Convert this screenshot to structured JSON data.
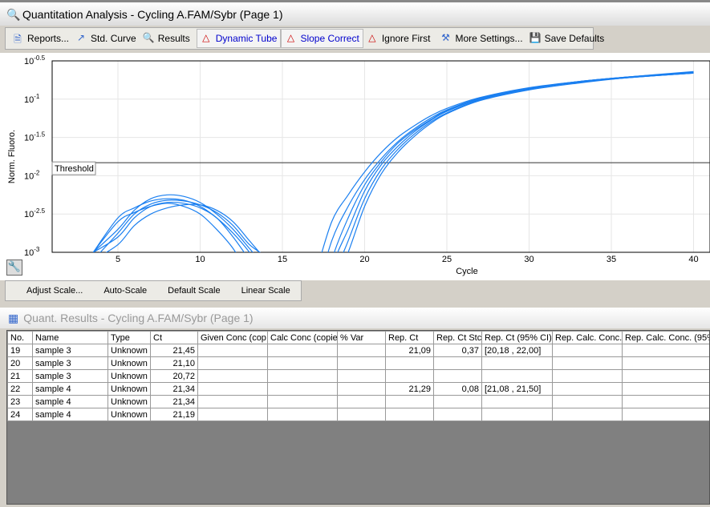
{
  "window": {
    "title": "Quantitation Analysis - Cycling A.FAM/Sybr (Page 1)"
  },
  "toolbar": [
    {
      "label": "Reports...",
      "icon": "report-icon",
      "active": false
    },
    {
      "label": "Std. Curve",
      "icon": "std-curve-icon",
      "active": false
    },
    {
      "label": "Results",
      "icon": "results-icon",
      "active": false
    },
    {
      "label": "Dynamic Tube",
      "icon": "dynamic-tube-icon",
      "active": true
    },
    {
      "label": "Slope Correct",
      "icon": "slope-correct-icon",
      "active": true
    },
    {
      "label": "Ignore First",
      "icon": "ignore-first-icon",
      "active": false
    },
    {
      "label": "More Settings...",
      "icon": "settings-tools-icon",
      "active": false
    },
    {
      "label": "Save Defaults",
      "icon": "save-icon",
      "active": false
    }
  ],
  "scalebar": {
    "adjust": "Adjust Scale...",
    "auto": "Auto-Scale",
    "default": "Default Scale",
    "linear": "Linear Scale"
  },
  "results": {
    "title": "Quant. Results - Cycling A.FAM/Sybr (Page 1)",
    "columns": [
      "No.",
      "Name",
      "Type",
      "Ct",
      "Given Conc (cop",
      "Calc Conc (copie",
      "% Var",
      "Rep. Ct",
      "Rep. Ct Stc",
      "Rep. Ct (95% CI)",
      "Rep. Calc. Conc.",
      "Rep. Calc. Conc. (95%"
    ],
    "rows": [
      [
        "19",
        "sample 3",
        "Unknown",
        "21,45",
        "",
        "",
        "",
        "21,09",
        "0,37",
        "[20,18 , 22,00]",
        "",
        ""
      ],
      [
        "20",
        "sample 3",
        "Unknown",
        "21,10",
        "",
        "",
        "",
        "",
        "",
        "",
        "",
        ""
      ],
      [
        "21",
        "sample 3",
        "Unknown",
        "20,72",
        "",
        "",
        "",
        "",
        "",
        "",
        "",
        ""
      ],
      [
        "22",
        "sample 4",
        "Unknown",
        "21,34",
        "",
        "",
        "",
        "21,29",
        "0,08",
        "[21,08 , 21,50]",
        "",
        ""
      ],
      [
        "23",
        "sample 4",
        "Unknown",
        "21,34",
        "",
        "",
        "",
        "",
        "",
        "",
        "",
        ""
      ],
      [
        "24",
        "sample 4",
        "Unknown",
        "21,19",
        "",
        "",
        "",
        "",
        "",
        "",
        "",
        ""
      ]
    ]
  },
  "chart_data": {
    "type": "line",
    "xlabel": "Cycle",
    "ylabel": "Norm. Fluoro.",
    "xlim": [
      1,
      41
    ],
    "ylim_log10": [
      -3,
      -0.5
    ],
    "yscale": "log",
    "xticks": [
      5,
      10,
      15,
      20,
      25,
      30,
      35,
      40
    ],
    "yticks": [
      {
        "exp": "-0.5",
        "v": -0.5
      },
      {
        "exp": "-1",
        "v": -1
      },
      {
        "exp": "-1.5",
        "v": -1.5
      },
      {
        "exp": "-2",
        "v": -2
      },
      {
        "exp": "-2.5",
        "v": -2.5
      },
      {
        "exp": "-3",
        "v": -3
      }
    ],
    "threshold": {
      "label": "Threshold",
      "log10": -1.83
    },
    "color": "#1a7ff0",
    "cycles_amp": [
      17,
      18,
      19,
      20,
      21,
      22,
      23,
      24,
      25,
      27,
      30,
      33,
      36,
      40
    ],
    "cycles_hump": [
      3.5,
      5,
      6,
      7,
      8,
      9,
      10,
      11,
      12,
      13,
      14
    ],
    "amplification_log10": [
      [
        -3.3,
        -2.6,
        -2.25,
        -1.95,
        -1.7,
        -1.5,
        -1.35,
        -1.22,
        -1.12,
        -0.98,
        -0.85,
        -0.77,
        -0.71,
        -0.65
      ],
      [
        -3.6,
        -2.85,
        -2.4,
        -2.05,
        -1.78,
        -1.56,
        -1.39,
        -1.25,
        -1.14,
        -0.99,
        -0.86,
        -0.77,
        -0.71,
        -0.65
      ],
      [
        -3.9,
        -3.1,
        -2.55,
        -2.12,
        -1.82,
        -1.58,
        -1.41,
        -1.27,
        -1.15,
        -1.0,
        -0.86,
        -0.77,
        -0.71,
        -0.64
      ],
      [
        -4.0,
        -3.2,
        -2.7,
        -2.2,
        -1.86,
        -1.62,
        -1.43,
        -1.28,
        -1.16,
        -1.0,
        -0.86,
        -0.78,
        -0.72,
        -0.66
      ],
      [
        -4.2,
        -3.4,
        -2.85,
        -2.3,
        -1.92,
        -1.66,
        -1.46,
        -1.3,
        -1.18,
        -1.01,
        -0.87,
        -0.78,
        -0.72,
        -0.66
      ],
      [
        -4.3,
        -3.5,
        -3.0,
        -2.4,
        -1.98,
        -1.7,
        -1.49,
        -1.32,
        -1.19,
        -1.02,
        -0.88,
        -0.79,
        -0.72,
        -0.66
      ]
    ],
    "hump_log10": [
      [
        -3.0,
        -2.55,
        -2.42,
        -2.33,
        -2.3,
        -2.32,
        -2.4,
        -2.55,
        -2.75,
        -3.0,
        -3.3
      ],
      [
        -3.0,
        -2.7,
        -2.45,
        -2.3,
        -2.25,
        -2.27,
        -2.35,
        -2.5,
        -2.7,
        -2.95,
        -3.2
      ],
      [
        -3.0,
        -2.8,
        -2.55,
        -2.4,
        -2.35,
        -2.36,
        -2.42,
        -2.55,
        -2.8,
        -3.1,
        -3.4
      ],
      [
        -3.0,
        -2.6,
        -2.48,
        -2.4,
        -2.36,
        -2.4,
        -2.5,
        -2.7,
        -2.95,
        -3.3,
        -3.6
      ],
      [
        -3.1,
        -2.9,
        -2.65,
        -2.5,
        -2.42,
        -2.38,
        -2.38,
        -2.45,
        -2.6,
        -2.85,
        -3.1
      ],
      [
        -3.1,
        -2.75,
        -2.5,
        -2.37,
        -2.32,
        -2.33,
        -2.38,
        -2.48,
        -2.65,
        -2.9,
        -3.05
      ]
    ]
  }
}
